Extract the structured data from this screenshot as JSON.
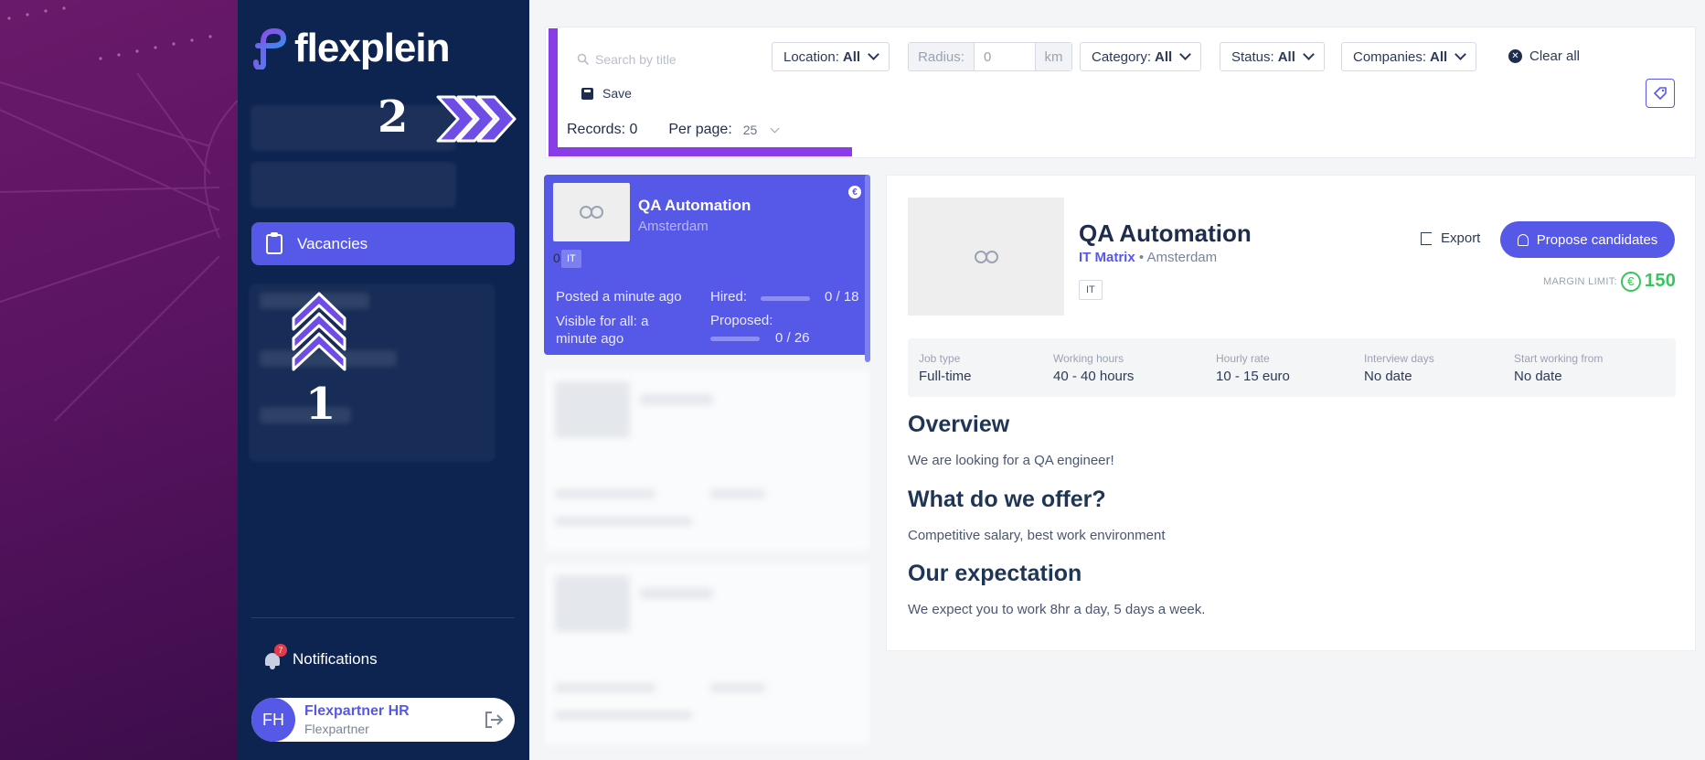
{
  "brand": {
    "name": "flexplein"
  },
  "sidebar": {
    "active_item": {
      "label": "Vacancies",
      "icon": "clipboard-icon"
    },
    "notifications": {
      "label": "Notifications",
      "count": "7"
    },
    "user": {
      "initials": "FH",
      "name": "Flexpartner HR",
      "role": "Flexpartner"
    }
  },
  "annotations": {
    "step1": "1",
    "step2": "2"
  },
  "filters": {
    "search_placeholder": "Search by title",
    "location": {
      "label": "Location:",
      "value": "All"
    },
    "radius": {
      "label": "Radius:",
      "value": "0",
      "unit": "km"
    },
    "category": {
      "label": "Category:",
      "value": "All"
    },
    "status": {
      "label": "Status:",
      "value": "All"
    },
    "companies": {
      "label": "Companies:",
      "value": "All"
    },
    "clear_all": "Clear all",
    "save": "Save",
    "records": "Records: 0",
    "per_page_label": "Per page:",
    "per_page_value": "25"
  },
  "vacancy_card": {
    "title": "QA Automation",
    "city": "Amsterdam",
    "count_prefix": "0",
    "tag": "IT",
    "posted": "Posted a minute ago",
    "visible": "Visible for all: a minute ago",
    "hired_label": "Hired:",
    "hired_value": "0 / 18",
    "hired_fraction": 0.0,
    "proposed_label": "Proposed:",
    "proposed_value": "0 / 26",
    "proposed_fraction": 0.0,
    "currency_badge": "€"
  },
  "detail": {
    "title": "QA Automation",
    "company": "IT Matrix",
    "separator": " • ",
    "city": "Amsterdam",
    "tag": "IT",
    "export_label": "Export",
    "propose_label": "Propose candidates",
    "margin_label": "MARGIN LIMIT:",
    "margin_currency": "€",
    "margin_value": "150",
    "info": [
      {
        "label": "Job type",
        "value": "Full-time"
      },
      {
        "label": "Working hours",
        "value": "40 - 40 hours"
      },
      {
        "label": "Hourly rate",
        "value": "10 - 15 euro"
      },
      {
        "label": "Interview days",
        "value": "No date"
      },
      {
        "label": "Start working from",
        "value": "No date"
      }
    ],
    "sections": [
      {
        "heading": "Overview",
        "text": "We are looking for a QA engineer!"
      },
      {
        "heading": "What do we offer?",
        "text": "Competitive salary, best work environment"
      },
      {
        "heading": "Our expectation",
        "text": "We expect you to work 8hr a day, 5 days a week."
      }
    ]
  },
  "colors": {
    "accent": "#5658e8",
    "sidebar": "#0e2450",
    "highlight": "#8a3ce6",
    "success": "#35c75a"
  }
}
